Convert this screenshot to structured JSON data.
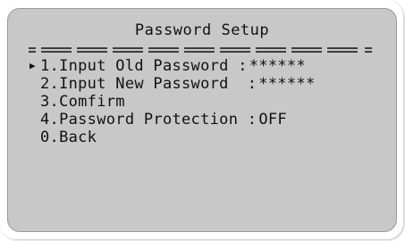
{
  "screen": {
    "title": "Password Setup",
    "cursor_glyph": "▶",
    "menu": [
      {
        "label": "1.Input Old Password :",
        "value": "******",
        "selected": true
      },
      {
        "label": "2.Input New Password  :",
        "value": "******",
        "selected": false
      },
      {
        "label": "3.Comfirm",
        "value": "",
        "selected": false
      },
      {
        "label": "4.Password Protection :",
        "value": "OFF",
        "selected": false
      },
      {
        "label": "0.Back",
        "value": "",
        "selected": false
      }
    ]
  },
  "colors": {
    "screen_background": "#c8c8c8",
    "text": "#111111"
  }
}
